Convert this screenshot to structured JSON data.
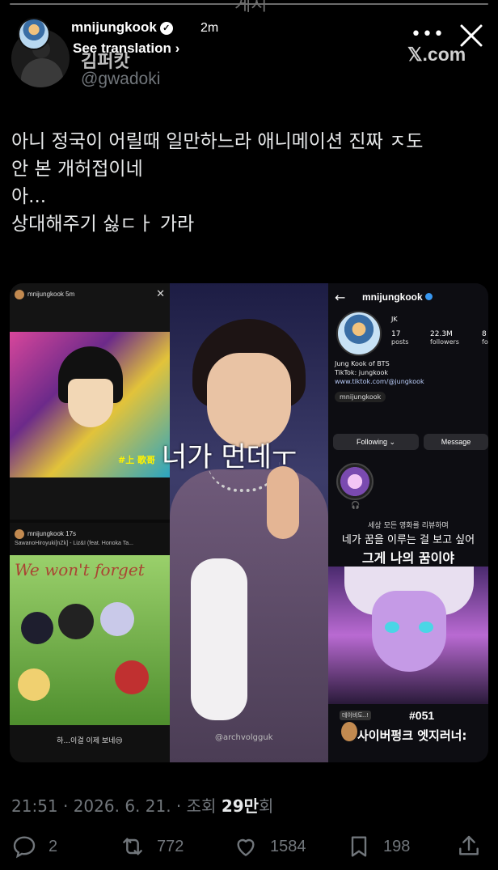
{
  "story": {
    "faded_title": "게시",
    "username": "mnijungkook",
    "verified_mark": "✓",
    "time": "2m",
    "see_translation": "See translation",
    "more_label": "•••",
    "watermark": "𝕏.com"
  },
  "tweet": {
    "display_name": "김퍼캇",
    "handle": "@gwadoki",
    "text_lines": [
      "아니 정국이 어릴때 일만하느라 애니메이션 진짜 ㅈ도",
      "안 본 개허접이네",
      "아...",
      "상대해주기 싫ㄷㅏ 가라"
    ],
    "timestamp": "21:51 · 2026. 6. 21. · 조회",
    "views": "29만",
    "views_suffix": "회"
  },
  "media": {
    "tile_a": {
      "user": "mnijungkook",
      "time": "5m",
      "tag": "#上 歌哥"
    },
    "tile_b": {
      "user": "mnijungkook",
      "time": "17s",
      "music": "SawanoHiroyuki[nZk] - Liz&I (feat. Honoka Ta...",
      "overlay": "We won't forget",
      "caption": "하...이걸 이제 보네😢"
    },
    "tile_c": {
      "overlay": "너가 먼데ㅜ",
      "watermark": "@archvolgguk"
    },
    "tile_d": {
      "username": "mnijungkook",
      "name": "JK",
      "posts_count": "17",
      "posts_label": "posts",
      "followers_count": "22.3M",
      "followers_label": "followers",
      "following_count": "8",
      "following_label": "fo",
      "bio_line1": "Jung Kook of BTS",
      "bio_line2": "TikTok: jungkook",
      "link": "www.tiktok.com/@jungkook",
      "threads": "mnijungkook",
      "following_btn": "Following ⌄",
      "message_btn": "Message",
      "sub1": "세상 모든 영화를 리뷰하며",
      "sub2": "네가 꿈을 이루는 걸 보고 싶어",
      "sub3": "그게 나의 꿈이야",
      "ep_small": "데이비도..!",
      "ep_num": "#051",
      "ep_title": "사이버펑크 엣지러너:"
    }
  },
  "actions": {
    "replies": "2",
    "reposts": "772",
    "likes": "1584",
    "bookmarks": "198"
  },
  "icons": [
    "reply-icon",
    "repost-icon",
    "like-icon",
    "bookmark-icon",
    "share-icon",
    "close-icon",
    "more-icon",
    "verified-icon",
    "chevron-right-icon"
  ]
}
